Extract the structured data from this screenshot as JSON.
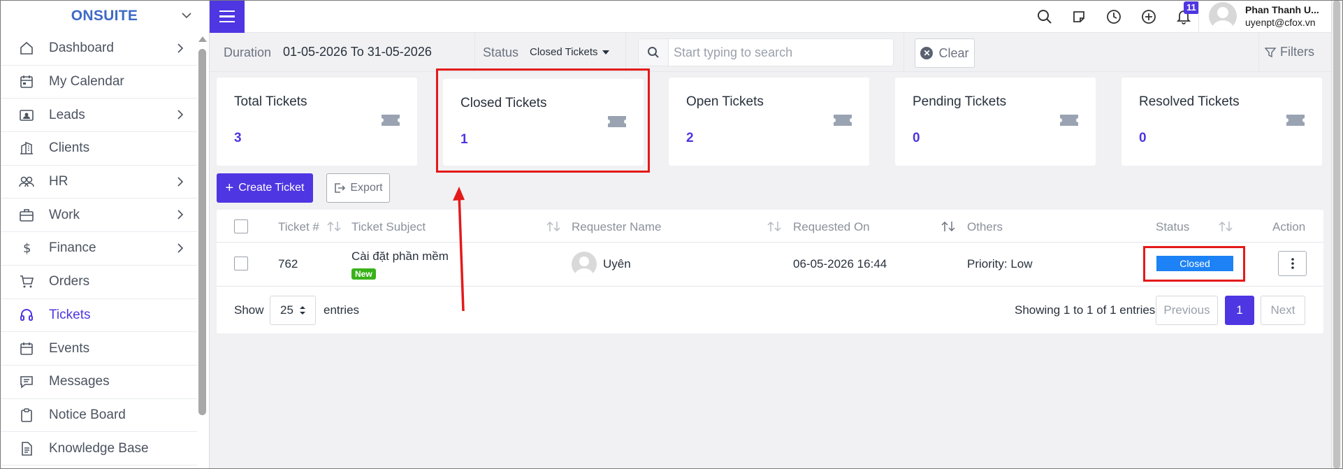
{
  "brand": {
    "name": "ONSUITE"
  },
  "sidebar": {
    "items": [
      {
        "label": "Dashboard",
        "icon": "home-icon",
        "has_arrow": true
      },
      {
        "label": "My Calendar",
        "icon": "calendar-icon",
        "has_arrow": false
      },
      {
        "label": "Leads",
        "icon": "contact-card-icon",
        "has_arrow": true
      },
      {
        "label": "Clients",
        "icon": "building-icon",
        "has_arrow": false
      },
      {
        "label": "HR",
        "icon": "people-icon",
        "has_arrow": true
      },
      {
        "label": "Work",
        "icon": "briefcase-icon",
        "has_arrow": true
      },
      {
        "label": "Finance",
        "icon": "dollar-icon",
        "has_arrow": true
      },
      {
        "label": "Orders",
        "icon": "cart-icon",
        "has_arrow": false
      },
      {
        "label": "Tickets",
        "icon": "headset-icon",
        "has_arrow": false,
        "active": true
      },
      {
        "label": "Events",
        "icon": "calendar-event-icon",
        "has_arrow": false
      },
      {
        "label": "Messages",
        "icon": "chat-icon",
        "has_arrow": false
      },
      {
        "label": "Notice Board",
        "icon": "clipboard-icon",
        "has_arrow": false
      },
      {
        "label": "Knowledge Base",
        "icon": "document-icon",
        "has_arrow": false
      }
    ]
  },
  "header": {
    "notification_count": "11",
    "user_name": "Phan Thanh U...",
    "user_email": "uyenpt@cfox.vn",
    "icons": [
      "search-icon",
      "sticky-note-icon",
      "clock-icon",
      "plus-circle-icon",
      "bell-icon"
    ]
  },
  "filters": {
    "duration_label": "Duration",
    "duration_value": "01-05-2026 To 31-05-2026",
    "status_label": "Status",
    "status_value": "Closed Tickets",
    "search_placeholder": "Start typing to search",
    "clear_label": "Clear",
    "filters_label": "Filters"
  },
  "cards": [
    {
      "title": "Total Tickets",
      "value": "3"
    },
    {
      "title": "Closed Tickets",
      "value": "1"
    },
    {
      "title": "Open Tickets",
      "value": "2"
    },
    {
      "title": "Pending Tickets",
      "value": "0"
    },
    {
      "title": "Resolved Tickets",
      "value": "0"
    }
  ],
  "actions": {
    "create_label": "Create Ticket",
    "export_label": "Export"
  },
  "table": {
    "columns": [
      "Ticket #",
      "Ticket Subject",
      "Requester Name",
      "Requested On",
      "Others",
      "Status",
      "Action"
    ],
    "rows": [
      {
        "ticket_no": "762",
        "subject": "Cài đặt phần mềm",
        "badge": "New",
        "requester": "Uyên",
        "requested_on": "06-05-2026 16:44",
        "others": "Priority: Low",
        "status": "Closed"
      }
    ],
    "show_label": "Show",
    "entries_value": "25",
    "entries_label": "entries",
    "info": "Showing 1 to 1 of 1 entries",
    "prev_label": "Previous",
    "page": "1",
    "next_label": "Next"
  },
  "colors": {
    "accent": "#4e36e2",
    "status_closed": "#1d82f5",
    "badge_new": "#39b21a",
    "annotation": "#e41a1a"
  }
}
